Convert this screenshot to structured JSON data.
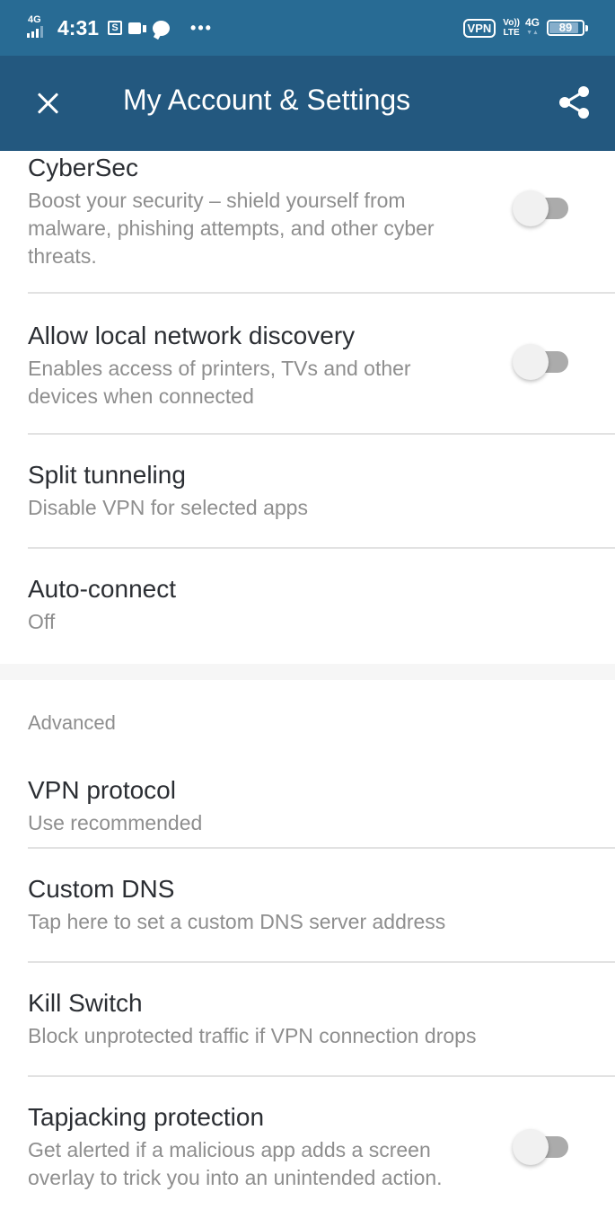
{
  "status_bar": {
    "network_type": "4G",
    "time": "4:31",
    "notification_icons": [
      "screenshot-icon",
      "video-icon",
      "chat-icon"
    ],
    "more_indicator": "•••",
    "vpn_label": "VPN",
    "volte_top": "Vo))",
    "volte_bottom": "LTE",
    "data_network": "4G",
    "battery_percent": "89",
    "battery_level": 0.89
  },
  "app_bar": {
    "title": "My Account & Settings",
    "close_icon": "close-icon",
    "share_icon": "share-icon",
    "background_color": "#23587f"
  },
  "settings": {
    "general": [
      {
        "label": "CyberSec",
        "description": "Boost your security – shield yourself from malware, phishing attempts, and other cyber threats.",
        "toggle": false
      },
      {
        "label": "Allow local network discovery",
        "description": "Enables access of printers, TVs and other devices when connected",
        "toggle": false
      },
      {
        "label": "Split tunneling",
        "description": "Disable VPN for selected apps"
      },
      {
        "label": "Auto-connect",
        "description": "Off"
      }
    ],
    "advanced_header": "Advanced",
    "advanced": [
      {
        "label": "VPN protocol",
        "description": "Use recommended"
      },
      {
        "label": "Custom DNS",
        "description": "Tap here to set a custom DNS server address"
      },
      {
        "label": "Kill Switch",
        "description": "Block unprotected traffic if VPN connection drops"
      },
      {
        "label": "Tapjacking protection",
        "description": "Get alerted if a malicious app adds a screen overlay to trick you into an unintended action.",
        "toggle": false
      }
    ]
  }
}
